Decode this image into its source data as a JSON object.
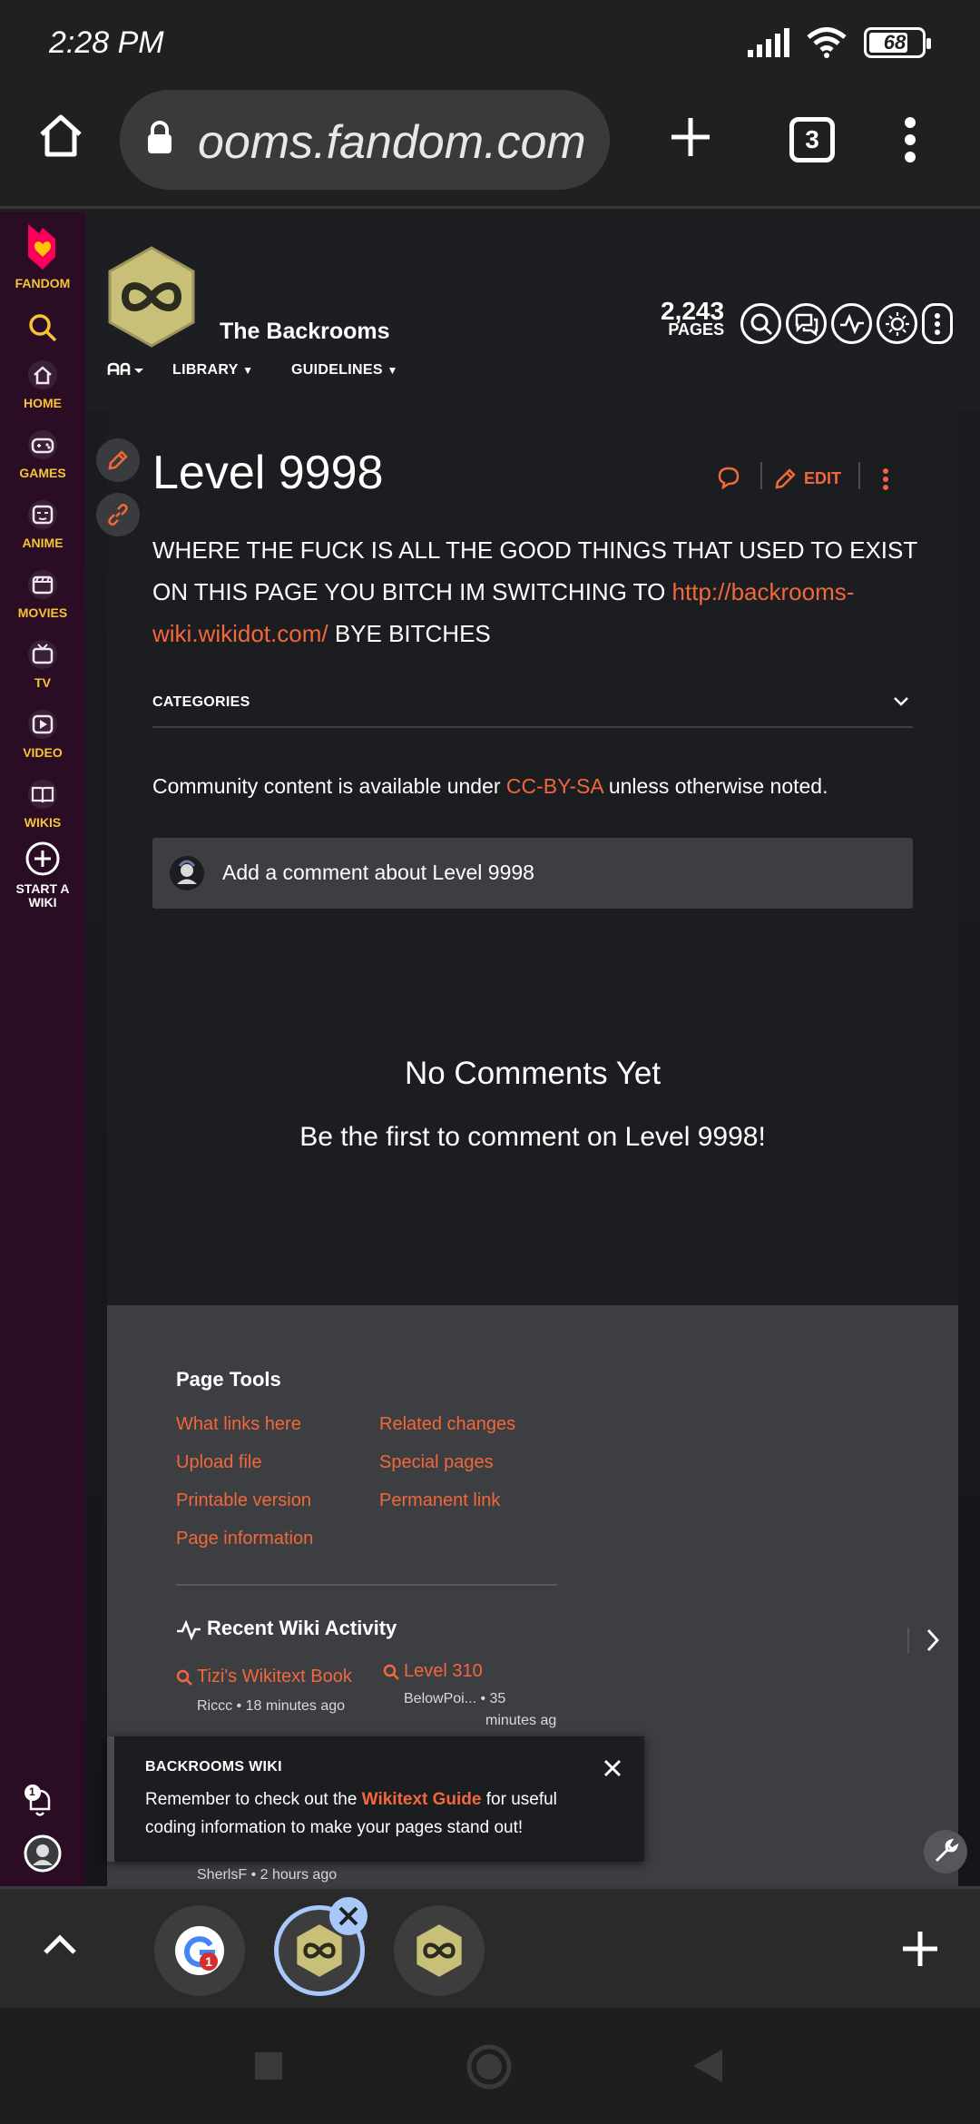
{
  "status_bar": {
    "time": "2:28 PM",
    "battery": "68",
    "battery_level_percent": 68
  },
  "browser": {
    "url": "ooms.fandom.com",
    "tab_count": "3"
  },
  "fandom_rail": {
    "logo_label": "FANDOM",
    "items": [
      {
        "label": "HOME",
        "icon": "home-icon"
      },
      {
        "label": "GAMES",
        "icon": "gamepad-icon"
      },
      {
        "label": "ANIME",
        "icon": "anime-icon"
      },
      {
        "label": "MOVIES",
        "icon": "clapperboard-icon"
      },
      {
        "label": "TV",
        "icon": "tv-icon"
      },
      {
        "label": "VIDEO",
        "icon": "play-icon"
      },
      {
        "label": "WIKIS",
        "icon": "book-icon"
      }
    ],
    "start_wiki": "START A WIKI",
    "notification_count": "1"
  },
  "wiki_header": {
    "name": "The Backrooms",
    "tabs": [
      "LIBRARY",
      "GUIDELINES"
    ],
    "pages_count": "2,243",
    "pages_label": "PAGES"
  },
  "article": {
    "title": "Level 9998",
    "edit_label": "EDIT",
    "body_before": "WHERE THE FUCK IS ALL THE GOOD THINGS THAT USED TO EXIST ON THIS PAGE YOU BITCH IM SWITCHING TO ",
    "body_link": "http://backrooms-wiki.wikidot.com/",
    "body_after": " BYE BITCHES",
    "categories_label": "CATEGORIES",
    "license_before": "Community content is available under ",
    "license_link": "CC-BY-SA",
    "license_after": " unless otherwise noted."
  },
  "comments": {
    "placeholder": "Add a comment about Level 9998",
    "empty_title": "No Comments Yet",
    "empty_subtitle": "Be the first to comment on Level 9998!"
  },
  "footer": {
    "page_tools_title": "Page Tools",
    "links_left": [
      "What links here",
      "Upload file",
      "Printable version",
      "Page information"
    ],
    "links_right": [
      "Related changes",
      "Special pages",
      "Permanent link"
    ],
    "recent_activity_title": "Recent Wiki Activity",
    "activity": [
      {
        "title": "Tizi's Wikitext Book",
        "meta": "Riccc • 18 minutes ago"
      },
      {
        "title": "Level 310",
        "meta_line1": "BelowPoi... • 35",
        "meta_line2": "minutes ag"
      }
    ],
    "last_meta": "SherlsF • 2 hours ago"
  },
  "banner": {
    "title": "BACKROOMS WIKI",
    "text_before": "Remember to check out the ",
    "text_link": "Wikitext Guide",
    "text_after": " for useful coding information to make your pages stand out!"
  },
  "colors": {
    "accent": "#f1683a",
    "rail_bg": "#2a0d25",
    "rail_label": "#f6c434"
  }
}
